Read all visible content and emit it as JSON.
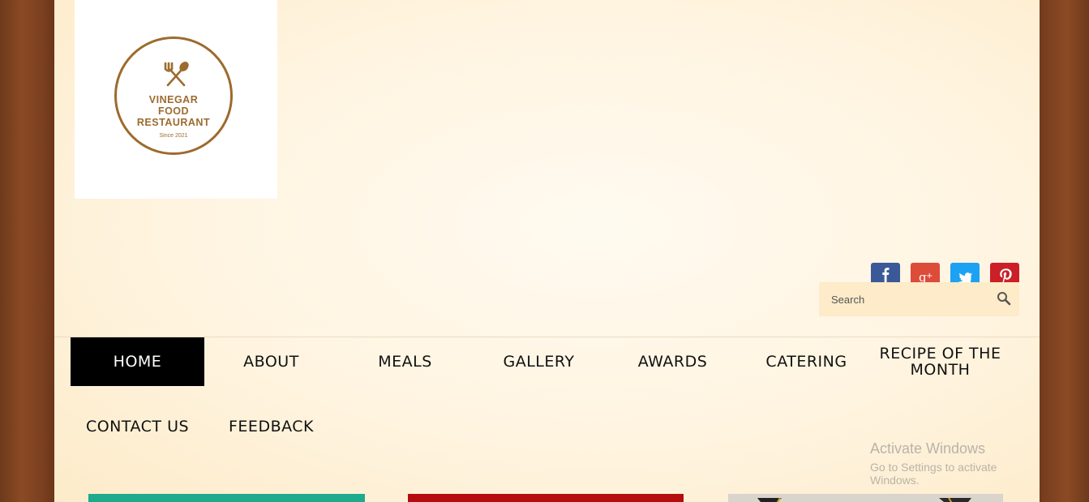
{
  "logo": {
    "line1": "VINEGAR",
    "line2": "FOOD",
    "line3": "RESTAURANT",
    "since": "Since 2021",
    "color": "#9c6b2e"
  },
  "social": [
    {
      "name": "facebook",
      "glyph": "f",
      "color": "#3b5998"
    },
    {
      "name": "google-plus",
      "glyph": "g+",
      "color": "#dd4b39"
    },
    {
      "name": "twitter",
      "glyph": "twitter-bird",
      "color": "#1da1f2"
    },
    {
      "name": "pinterest",
      "glyph": "p",
      "color": "#cb2027"
    }
  ],
  "search": {
    "placeholder": "Search",
    "icon": "search-icon"
  },
  "nav": {
    "items": [
      {
        "label": "HOME",
        "active": true
      },
      {
        "label": "ABOUT"
      },
      {
        "label": "MEALS"
      },
      {
        "label": "GALLERY"
      },
      {
        "label": "AWARDS"
      },
      {
        "label": "CATERING"
      },
      {
        "label": "RECIPE OF THE MONTH"
      },
      {
        "label": "CONTACT US"
      },
      {
        "label": "FEEDBACK"
      }
    ]
  },
  "watermark": {
    "title": "Activate Windows",
    "subtitle": "Go to Settings to activate Windows."
  },
  "colors": {
    "wood": "#6b3619",
    "page": "#fff4e0",
    "active_nav_bg": "#000000",
    "card1": "#1eaa8c",
    "card2": "#b50d0d"
  }
}
